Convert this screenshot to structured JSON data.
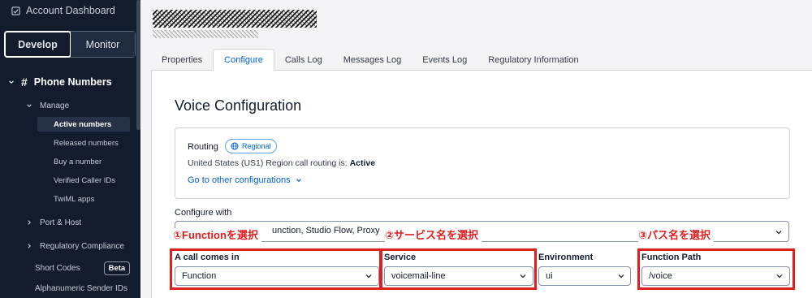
{
  "sidebar": {
    "account_dashboard": "Account Dashboard",
    "tabs": {
      "develop": "Develop",
      "monitor": "Monitor"
    },
    "section_title": "Phone Numbers",
    "manage": "Manage",
    "items": [
      {
        "label": "Active numbers",
        "active": true
      },
      {
        "label": "Released numbers"
      },
      {
        "label": "Buy a number"
      },
      {
        "label": "Verified Caller IDs"
      },
      {
        "label": "TwiML apps"
      }
    ],
    "port_host": "Port & Host",
    "regulatory": "Regulatory Compliance",
    "short_codes": "Short Codes",
    "beta": "Beta",
    "alnum": "Alphanumeric Sender IDs"
  },
  "top_tabs": [
    "Properties",
    "Configure",
    "Calls Log",
    "Messages Log",
    "Events Log",
    "Regulatory Information"
  ],
  "active_tab": "Configure",
  "main": {
    "title": "Voice Configuration",
    "routing": {
      "label": "Routing",
      "badge": "Regional",
      "status_prefix": "United States (US1) Region call routing is: ",
      "status_value": "Active",
      "link": "Go to other configurations"
    },
    "configure_with_label": "Configure with",
    "configure_with_value": "unction, Studio Flow, Proxy",
    "annotations": {
      "step1": "①Functionを選択",
      "step2": "②サービス名を選択",
      "step3": "③パス名を選択"
    },
    "fields": {
      "call_label": "A call comes in",
      "call_value": "Function",
      "service_label": "Service",
      "service_value": "voicemail-line",
      "env_label": "Environment",
      "env_value": "ui",
      "path_label": "Function Path",
      "path_value": "/voice"
    }
  },
  "colors": {
    "sidebar_bg": "#121c2d",
    "accent_blue": "#0263e0",
    "annotation_red": "#e01e1e"
  }
}
